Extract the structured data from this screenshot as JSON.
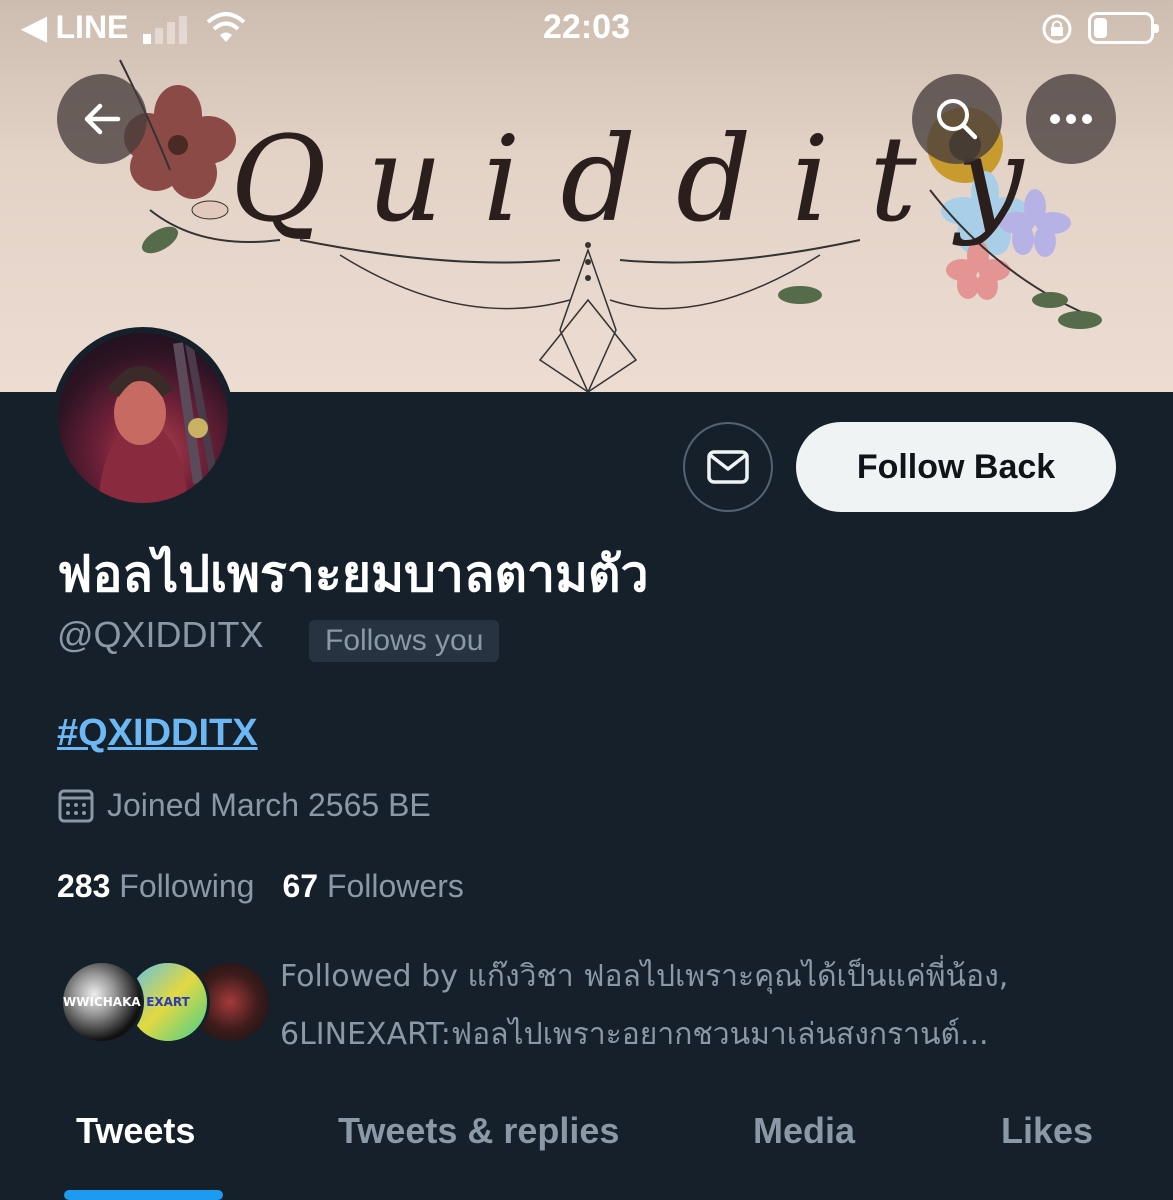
{
  "status_bar": {
    "carrier": "◀ LINE",
    "time": "22:03"
  },
  "banner": {
    "title": "Quiddity"
  },
  "profile": {
    "display_name": "ฟอลไปเพราะยมบาลตามตัว",
    "handle": "@QXIDDITX",
    "follows_you_label": "Follows you",
    "hashtag": "#QXIDDITX",
    "joined": "Joined March 2565 BE",
    "following_count": "283",
    "following_label": "Following",
    "followers_count": "67",
    "followers_label": "Followers",
    "followed_by_line1": "Followed by แก๊งวิชา ฟอลไปเพราะคุณได้เป็นแค่พี่น้อง,",
    "followed_by_line2": "6LINEXART:ฟอลไปเพราะอยากชวนมาเล่นสงกรานต์...",
    "follower_avatar_1": "WWICHAKAN",
    "follower_avatar_2": "EXART"
  },
  "actions": {
    "follow_back_label": "Follow Back"
  },
  "tabs": [
    {
      "label": "Tweets",
      "active": true
    },
    {
      "label": "Tweets & replies",
      "active": false
    },
    {
      "label": "Media",
      "active": false
    },
    {
      "label": "Likes",
      "active": false
    }
  ],
  "colors": {
    "background": "#15202b",
    "accent": "#1d9bf0",
    "secondary_text": "#8b98a5"
  },
  "icons": [
    "back-arrow-icon",
    "search-icon",
    "more-icon",
    "mail-icon",
    "calendar-icon"
  ]
}
